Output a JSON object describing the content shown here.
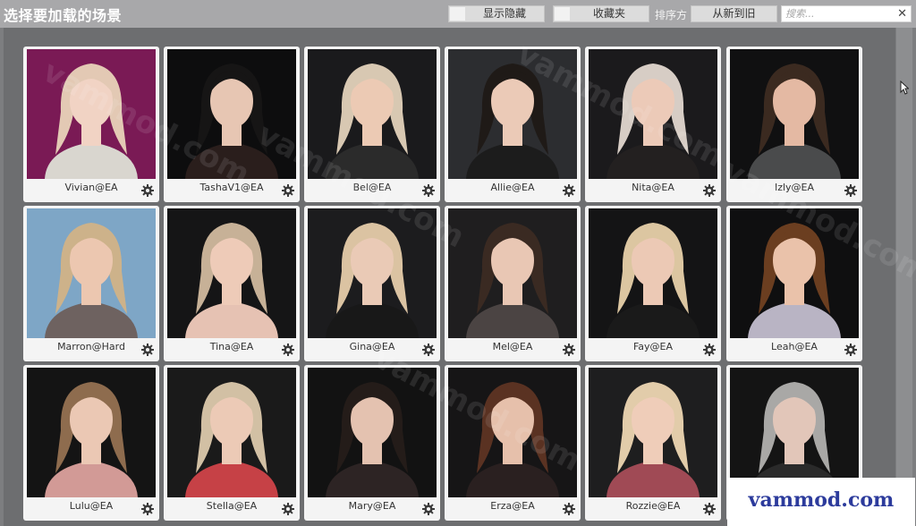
{
  "header": {
    "title": "选择要加载的场景",
    "show_hidden_label": "显示隐藏",
    "favorites_label": "收藏夹",
    "sort_label": "排序方",
    "sort_value": "从新到旧",
    "search_placeholder": "搜索...",
    "clear_icon": "✕"
  },
  "watermark": {
    "text": "vammod.com",
    "badge_text": "vammod.com"
  },
  "scenes": [
    {
      "name": "Vivian@EA",
      "bg": "#7a1a55",
      "hair": "#e3c9b4",
      "skin": "#f1d3c4",
      "cloth": "#d9d6cf"
    },
    {
      "name": "TashaV1@EA",
      "bg": "#0d0d0e",
      "hair": "#161515",
      "skin": "#e7c6b3",
      "cloth": "#2a1e1c"
    },
    {
      "name": "Bel@EA",
      "bg": "#1a1a1c",
      "hair": "#d8c8b2",
      "skin": "#eccab4",
      "cloth": "#2b2b2b"
    },
    {
      "name": "Allie@EA",
      "bg": "#2c2d30",
      "hair": "#1f1a17",
      "skin": "#ebcab7",
      "cloth": "#1c1c1c"
    },
    {
      "name": "Nita@EA",
      "bg": "#1b1a1c",
      "hair": "#d7cdc5",
      "skin": "#eccab8",
      "cloth": "#232020"
    },
    {
      "name": "Izly@EA",
      "bg": "#101011",
      "hair": "#3b2a20",
      "skin": "#e4b9a3",
      "cloth": "#4a4b4c"
    },
    {
      "name": "Marron@Hard",
      "bg": "#7ea6c6",
      "hair": "#cdb28a",
      "skin": "#ecc7b0",
      "cloth": "#6e6260"
    },
    {
      "name": "Tina@EA",
      "bg": "#151516",
      "hair": "#c7b197",
      "skin": "#eecbb8",
      "cloth": "#e6c2b3"
    },
    {
      "name": "Gina@EA",
      "bg": "#1c1c1e",
      "hair": "#dbc3a2",
      "skin": "#eacab6",
      "cloth": "#181818"
    },
    {
      "name": "Mel@EA",
      "bg": "#1f1e1f",
      "hair": "#3a2a22",
      "skin": "#e9c7b4",
      "cloth": "#4b4443"
    },
    {
      "name": "Fay@EA",
      "bg": "#141415",
      "hair": "#dcc6a1",
      "skin": "#ecc9b5",
      "cloth": "#1a1a1a"
    },
    {
      "name": "Leah@EA",
      "bg": "#0f0f10",
      "hair": "#6b3e20",
      "skin": "#eac2aa",
      "cloth": "#b9b4c4"
    },
    {
      "name": "Lulu@EA",
      "bg": "#141414",
      "hair": "#8e6c4e",
      "skin": "#ebc8b4",
      "cloth": "#d29a96"
    },
    {
      "name": "Stella@EA",
      "bg": "#1a1a1a",
      "hair": "#d2c0a4",
      "skin": "#eccab6",
      "cloth": "#c64146"
    },
    {
      "name": "Mary@EA",
      "bg": "#121212",
      "hair": "#241c19",
      "skin": "#e4c2b0",
      "cloth": "#2d2424"
    },
    {
      "name": "Erza@EA",
      "bg": "#161516",
      "hair": "#5a3222",
      "skin": "#e6c0ab",
      "cloth": "#2a2020"
    },
    {
      "name": "Rozzie@EA",
      "bg": "#1e1e1f",
      "hair": "#e2ccaa",
      "skin": "#efcdb9",
      "cloth": "#a04a55"
    },
    {
      "name": "",
      "bg": "#141414",
      "hair": "#a9a8a6",
      "skin": "#e2c6b9",
      "cloth": "#2a2a2a"
    }
  ]
}
